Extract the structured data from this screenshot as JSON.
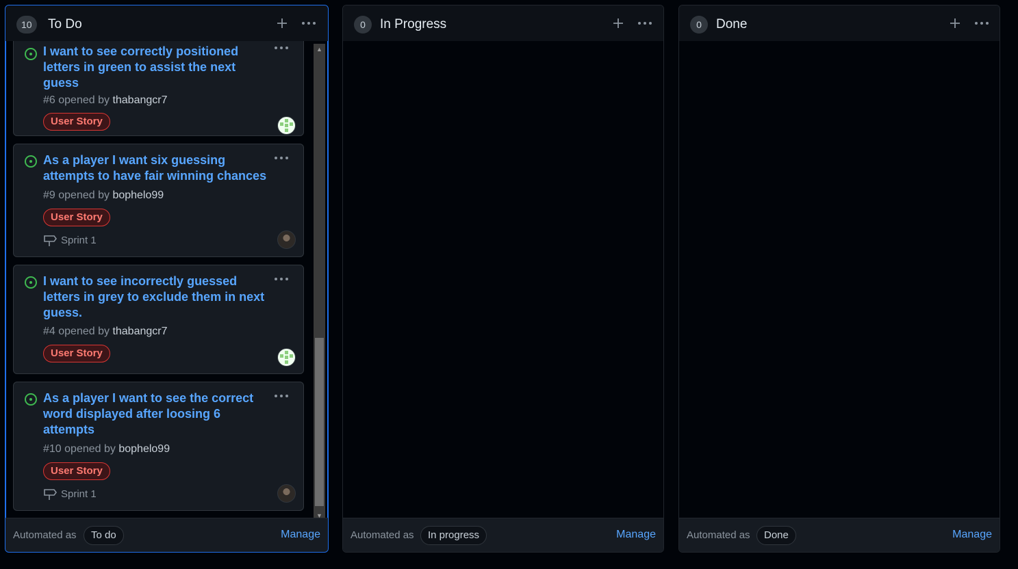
{
  "columns": [
    {
      "count": "10",
      "title": "To Do",
      "automated_label": "Automated as",
      "automated_value": "To do",
      "manage_label": "Manage"
    },
    {
      "count": "0",
      "title": "In Progress",
      "automated_label": "Automated as",
      "automated_value": "In progress",
      "manage_label": "Manage"
    },
    {
      "count": "0",
      "title": "Done",
      "automated_label": "Automated as",
      "automated_value": "Done",
      "manage_label": "Manage"
    }
  ],
  "cards": [
    {
      "title_lines": [
        "I want to see correctly positioned",
        "letters in green to assist the next",
        "guess"
      ],
      "number": "#6",
      "opened_by": "opened by",
      "user": "thabangcr7",
      "label": "User Story",
      "milestone": ""
    },
    {
      "title_lines": [
        "As a player I want six guessing",
        "attempts to have fair winning chances"
      ],
      "number": "#9",
      "opened_by": "opened by",
      "user": "bophelo99",
      "label": "User Story",
      "milestone": "Sprint 1"
    },
    {
      "title_lines": [
        "I want to see incorrectly guessed",
        "letters in grey to exclude them in next",
        "guess."
      ],
      "number": "#4",
      "opened_by": "opened by",
      "user": "thabangcr7",
      "label": "User Story",
      "milestone": ""
    },
    {
      "title_lines": [
        "As a player I want to see the correct",
        "word displayed after loosing 6",
        "attempts"
      ],
      "number": "#10",
      "opened_by": "opened by",
      "user": "bophelo99",
      "label": "User Story",
      "milestone": "Sprint 1"
    }
  ],
  "colors": {
    "accent_link": "#58a6ff",
    "label_red": "#ff7b72",
    "status_open_green": "#3fb950",
    "active_border": "#1f6feb"
  },
  "icons": [
    "plus-icon",
    "kebab-icon",
    "issue-open-icon",
    "milestone-icon",
    "scroll-up-arrow",
    "scroll-down-arrow"
  ]
}
